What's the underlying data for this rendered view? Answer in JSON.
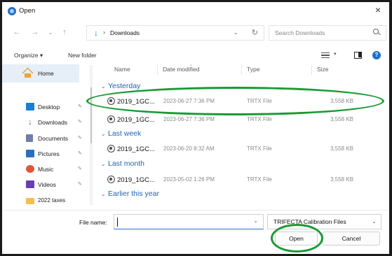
{
  "window": {
    "title": "Open",
    "close_symbol": "×"
  },
  "address": {
    "back": "←",
    "forward": "→",
    "recent": "⌄",
    "up": "↑",
    "separator": "›",
    "location": "Downloads",
    "dropdown": "⌄",
    "refresh": "↻",
    "search_placeholder": "Search Downloads"
  },
  "toolbar": {
    "organize_label": "Organize ▾",
    "new_folder_label": "New folder",
    "view_dropdown": "▾",
    "help_symbol": "?"
  },
  "sidebar": {
    "items": [
      {
        "label": "Home",
        "icon": "home-icon",
        "pinned": false
      },
      {
        "label": "Desktop",
        "icon": "desktop-icon",
        "pinned": true,
        "color": "#1a7fd4"
      },
      {
        "label": "Downloads",
        "icon": "download-icon",
        "pinned": true,
        "color": "#1b8a2e"
      },
      {
        "label": "Documents",
        "icon": "documents-icon",
        "pinned": true,
        "color": "#6f7fa8"
      },
      {
        "label": "Pictures",
        "icon": "pictures-icon",
        "pinned": true,
        "color": "#2b6fc0"
      },
      {
        "label": "Music",
        "icon": "music-icon",
        "pinned": true,
        "color": "#e2553a"
      },
      {
        "label": "Videos",
        "icon": "videos-icon",
        "pinned": true,
        "color": "#6a3fb0"
      },
      {
        "label": "2022 taxes",
        "icon": "folder-icon",
        "pinned": false,
        "color": "#f2c14e"
      }
    ],
    "pin_symbol": "📌"
  },
  "columns": {
    "name": "Name",
    "date": "Date modified",
    "type": "Type",
    "size": "Size"
  },
  "groups": [
    {
      "label": "Yesterday",
      "files": [
        {
          "name": "2019_1GC...",
          "date": "2023-06-27 7:36 PM",
          "type": "TRTX File",
          "size": "3,558 KB"
        },
        {
          "name": "2019_1GC...",
          "date": "2023-06-27 7:36 PM",
          "type": "TRTX File",
          "size": "3,558 KB"
        }
      ]
    },
    {
      "label": "Last week",
      "files": [
        {
          "name": "2019_1GC...",
          "date": "2023-06-20 8:32 AM",
          "type": "TRTX File",
          "size": "3,558 KB"
        }
      ]
    },
    {
      "label": "Last month",
      "files": [
        {
          "name": "2019_1GC...",
          "date": "2023-05-02 1:26 PM",
          "type": "TRTX File",
          "size": "3,558 KB"
        }
      ]
    },
    {
      "label": "Earlier this year",
      "files": []
    }
  ],
  "group_caret": "⌄",
  "footer": {
    "file_name_label": "File name:",
    "file_name_value": "",
    "dropdown": "⌄",
    "filter_value": "TRIFECTA Calibration Files",
    "open_label": "Open",
    "cancel_label": "Cancel"
  },
  "colors": {
    "annotation": "#1a9a35",
    "accent": "#2a6fd0",
    "group_text": "#1f63b0"
  }
}
